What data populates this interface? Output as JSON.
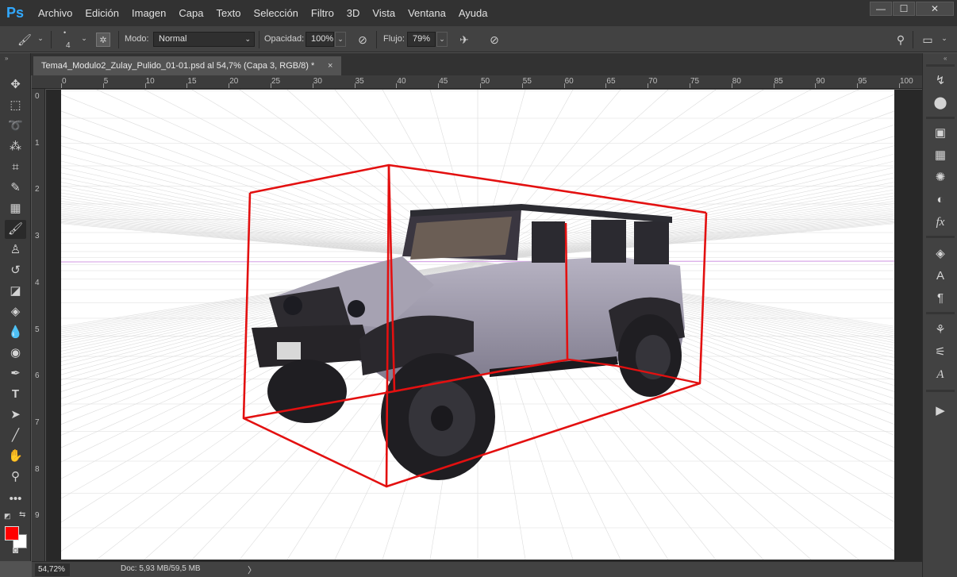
{
  "app": {
    "logo": "Ps"
  },
  "menu": [
    "Archivo",
    "Edición",
    "Imagen",
    "Capa",
    "Texto",
    "Selección",
    "Filtro",
    "3D",
    "Vista",
    "Ventana",
    "Ayuda"
  ],
  "window_controls": {
    "minimize": "—",
    "maximize": "☐",
    "close": "✕"
  },
  "options": {
    "brush_size": "4",
    "mode_label": "Modo:",
    "mode_value": "Normal",
    "opacity_label": "Opacidad:",
    "opacity_value": "100%",
    "flow_label": "Flujo:",
    "flow_value": "79%"
  },
  "document": {
    "tab_title": "Tema4_Modulo2_Zulay_Pulido_01-01.psd al 54,7% (Capa 3, RGB/8) *",
    "close": "×"
  },
  "ruler": {
    "top_ticks": [
      "0",
      "5",
      "10",
      "15",
      "20",
      "25",
      "30",
      "35",
      "40",
      "45",
      "50",
      "55",
      "60",
      "65",
      "70",
      "75",
      "80",
      "85",
      "90",
      "95",
      "100"
    ],
    "left_ticks": [
      "0",
      "1",
      "2",
      "3",
      "4",
      "5",
      "6",
      "7",
      "8",
      "9"
    ]
  },
  "status": {
    "zoom": "54,72%",
    "doc_info": "Doc: 5,93 MB/59,5 MB",
    "arrow": "〉"
  },
  "colors": {
    "foreground": "#ff0000",
    "background": "#ffffff",
    "guide_line": "#d9a9e8",
    "box_stroke": "#e31010"
  },
  "tools": [
    "move-icon",
    "marquee-icon",
    "lasso-icon",
    "quick-select-icon",
    "crop-icon",
    "eyedropper-icon",
    "healing-icon",
    "brush-icon",
    "clone-stamp-icon",
    "history-brush-icon",
    "eraser-icon",
    "paint-bucket-icon",
    "blur-icon",
    "dodge-icon",
    "pen-icon",
    "type-icon",
    "path-select-icon",
    "line-icon",
    "hand-icon",
    "zoom-icon",
    "more-tools-icon"
  ],
  "dock_icons": [
    "history-icon",
    "color-icon",
    "libraries-icon",
    "swatches-icon",
    "brushes-icon",
    "adjustments-icon",
    "styles-icon",
    "layers-icon",
    "character-icon",
    "paragraph-icon",
    "brush-settings-icon",
    "properties-icon",
    "glyphs-icon",
    "actions-icon"
  ]
}
